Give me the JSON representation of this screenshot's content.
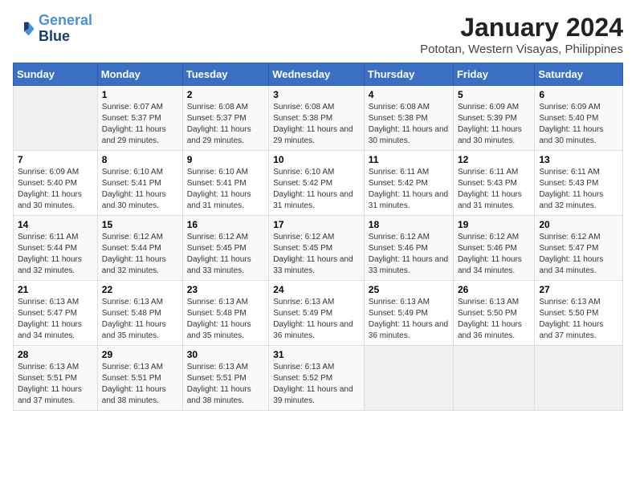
{
  "logo": {
    "line1": "General",
    "line2": "Blue"
  },
  "title": "January 2024",
  "subtitle": "Pototan, Western Visayas, Philippines",
  "days_of_week": [
    "Sunday",
    "Monday",
    "Tuesday",
    "Wednesday",
    "Thursday",
    "Friday",
    "Saturday"
  ],
  "weeks": [
    [
      {
        "day": "",
        "sunrise": "",
        "sunset": "",
        "daylight": ""
      },
      {
        "day": "1",
        "sunrise": "Sunrise: 6:07 AM",
        "sunset": "Sunset: 5:37 PM",
        "daylight": "Daylight: 11 hours and 29 minutes."
      },
      {
        "day": "2",
        "sunrise": "Sunrise: 6:08 AM",
        "sunset": "Sunset: 5:37 PM",
        "daylight": "Daylight: 11 hours and 29 minutes."
      },
      {
        "day": "3",
        "sunrise": "Sunrise: 6:08 AM",
        "sunset": "Sunset: 5:38 PM",
        "daylight": "Daylight: 11 hours and 29 minutes."
      },
      {
        "day": "4",
        "sunrise": "Sunrise: 6:08 AM",
        "sunset": "Sunset: 5:38 PM",
        "daylight": "Daylight: 11 hours and 30 minutes."
      },
      {
        "day": "5",
        "sunrise": "Sunrise: 6:09 AM",
        "sunset": "Sunset: 5:39 PM",
        "daylight": "Daylight: 11 hours and 30 minutes."
      },
      {
        "day": "6",
        "sunrise": "Sunrise: 6:09 AM",
        "sunset": "Sunset: 5:40 PM",
        "daylight": "Daylight: 11 hours and 30 minutes."
      }
    ],
    [
      {
        "day": "7",
        "sunrise": "Sunrise: 6:09 AM",
        "sunset": "Sunset: 5:40 PM",
        "daylight": "Daylight: 11 hours and 30 minutes."
      },
      {
        "day": "8",
        "sunrise": "Sunrise: 6:10 AM",
        "sunset": "Sunset: 5:41 PM",
        "daylight": "Daylight: 11 hours and 30 minutes."
      },
      {
        "day": "9",
        "sunrise": "Sunrise: 6:10 AM",
        "sunset": "Sunset: 5:41 PM",
        "daylight": "Daylight: 11 hours and 31 minutes."
      },
      {
        "day": "10",
        "sunrise": "Sunrise: 6:10 AM",
        "sunset": "Sunset: 5:42 PM",
        "daylight": "Daylight: 11 hours and 31 minutes."
      },
      {
        "day": "11",
        "sunrise": "Sunrise: 6:11 AM",
        "sunset": "Sunset: 5:42 PM",
        "daylight": "Daylight: 11 hours and 31 minutes."
      },
      {
        "day": "12",
        "sunrise": "Sunrise: 6:11 AM",
        "sunset": "Sunset: 5:43 PM",
        "daylight": "Daylight: 11 hours and 31 minutes."
      },
      {
        "day": "13",
        "sunrise": "Sunrise: 6:11 AM",
        "sunset": "Sunset: 5:43 PM",
        "daylight": "Daylight: 11 hours and 32 minutes."
      }
    ],
    [
      {
        "day": "14",
        "sunrise": "Sunrise: 6:11 AM",
        "sunset": "Sunset: 5:44 PM",
        "daylight": "Daylight: 11 hours and 32 minutes."
      },
      {
        "day": "15",
        "sunrise": "Sunrise: 6:12 AM",
        "sunset": "Sunset: 5:44 PM",
        "daylight": "Daylight: 11 hours and 32 minutes."
      },
      {
        "day": "16",
        "sunrise": "Sunrise: 6:12 AM",
        "sunset": "Sunset: 5:45 PM",
        "daylight": "Daylight: 11 hours and 33 minutes."
      },
      {
        "day": "17",
        "sunrise": "Sunrise: 6:12 AM",
        "sunset": "Sunset: 5:45 PM",
        "daylight": "Daylight: 11 hours and 33 minutes."
      },
      {
        "day": "18",
        "sunrise": "Sunrise: 6:12 AM",
        "sunset": "Sunset: 5:46 PM",
        "daylight": "Daylight: 11 hours and 33 minutes."
      },
      {
        "day": "19",
        "sunrise": "Sunrise: 6:12 AM",
        "sunset": "Sunset: 5:46 PM",
        "daylight": "Daylight: 11 hours and 34 minutes."
      },
      {
        "day": "20",
        "sunrise": "Sunrise: 6:12 AM",
        "sunset": "Sunset: 5:47 PM",
        "daylight": "Daylight: 11 hours and 34 minutes."
      }
    ],
    [
      {
        "day": "21",
        "sunrise": "Sunrise: 6:13 AM",
        "sunset": "Sunset: 5:47 PM",
        "daylight": "Daylight: 11 hours and 34 minutes."
      },
      {
        "day": "22",
        "sunrise": "Sunrise: 6:13 AM",
        "sunset": "Sunset: 5:48 PM",
        "daylight": "Daylight: 11 hours and 35 minutes."
      },
      {
        "day": "23",
        "sunrise": "Sunrise: 6:13 AM",
        "sunset": "Sunset: 5:48 PM",
        "daylight": "Daylight: 11 hours and 35 minutes."
      },
      {
        "day": "24",
        "sunrise": "Sunrise: 6:13 AM",
        "sunset": "Sunset: 5:49 PM",
        "daylight": "Daylight: 11 hours and 36 minutes."
      },
      {
        "day": "25",
        "sunrise": "Sunrise: 6:13 AM",
        "sunset": "Sunset: 5:49 PM",
        "daylight": "Daylight: 11 hours and 36 minutes."
      },
      {
        "day": "26",
        "sunrise": "Sunrise: 6:13 AM",
        "sunset": "Sunset: 5:50 PM",
        "daylight": "Daylight: 11 hours and 36 minutes."
      },
      {
        "day": "27",
        "sunrise": "Sunrise: 6:13 AM",
        "sunset": "Sunset: 5:50 PM",
        "daylight": "Daylight: 11 hours and 37 minutes."
      }
    ],
    [
      {
        "day": "28",
        "sunrise": "Sunrise: 6:13 AM",
        "sunset": "Sunset: 5:51 PM",
        "daylight": "Daylight: 11 hours and 37 minutes."
      },
      {
        "day": "29",
        "sunrise": "Sunrise: 6:13 AM",
        "sunset": "Sunset: 5:51 PM",
        "daylight": "Daylight: 11 hours and 38 minutes."
      },
      {
        "day": "30",
        "sunrise": "Sunrise: 6:13 AM",
        "sunset": "Sunset: 5:51 PM",
        "daylight": "Daylight: 11 hours and 38 minutes."
      },
      {
        "day": "31",
        "sunrise": "Sunrise: 6:13 AM",
        "sunset": "Sunset: 5:52 PM",
        "daylight": "Daylight: 11 hours and 39 minutes."
      },
      {
        "day": "",
        "sunrise": "",
        "sunset": "",
        "daylight": ""
      },
      {
        "day": "",
        "sunrise": "",
        "sunset": "",
        "daylight": ""
      },
      {
        "day": "",
        "sunrise": "",
        "sunset": "",
        "daylight": ""
      }
    ]
  ]
}
